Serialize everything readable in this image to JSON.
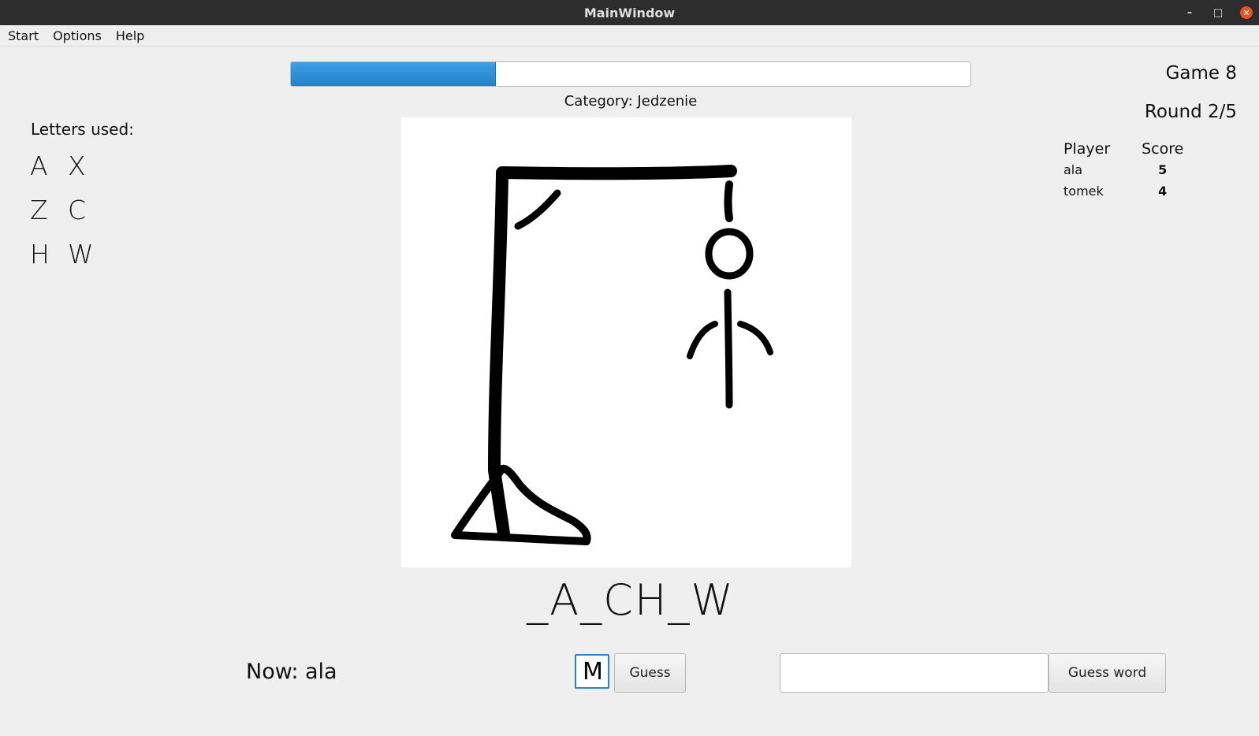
{
  "window": {
    "title": "MainWindow",
    "minimize": "–",
    "maximize": "□",
    "close": "✕"
  },
  "menu": {
    "items": [
      "Start",
      "Options",
      "Help"
    ]
  },
  "progress": {
    "fraction": 0.3
  },
  "category": "Category: Jedzenie",
  "game": "Game 8",
  "round": "Round 2/5",
  "letters_used": {
    "title": "Letters used:",
    "letters": [
      "A",
      "X",
      "Z",
      "C",
      "H",
      "W"
    ]
  },
  "word": "_A_CH_W",
  "scoreboard": {
    "headers": {
      "player": "Player",
      "score": "Score"
    },
    "rows": [
      {
        "player": "ala",
        "score": "5"
      },
      {
        "player": "tomek",
        "score": "4"
      }
    ]
  },
  "now": "Now: ala",
  "letter_input": {
    "value": "M"
  },
  "guess_button": "Guess",
  "word_input": {
    "value": ""
  },
  "guess_word_button": "Guess word",
  "drawing": {
    "stage": 8,
    "parts": [
      "base",
      "post",
      "beam",
      "brace",
      "rope",
      "head",
      "body",
      "arms"
    ]
  }
}
